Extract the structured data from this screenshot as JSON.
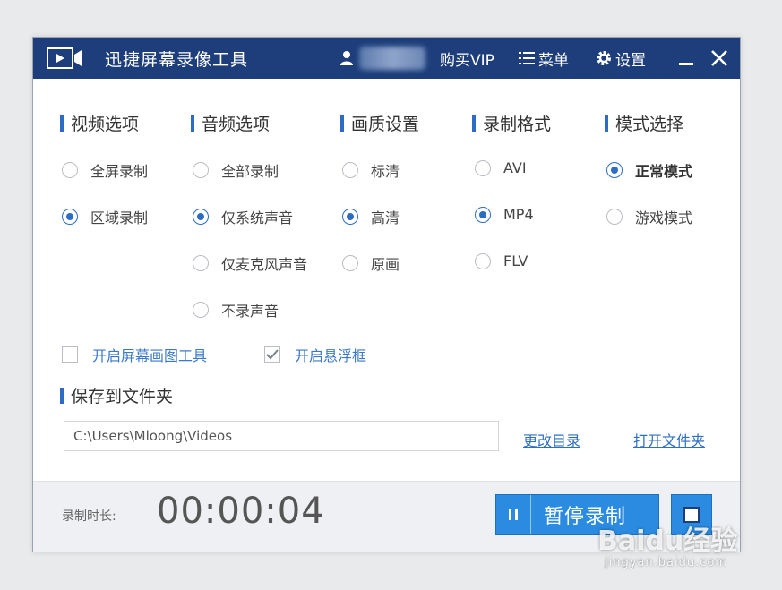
{
  "window": {
    "title": "迅捷屏幕录像工具",
    "buy_vip": "购买VIP",
    "menu": "菜单",
    "settings": "设置"
  },
  "sections": {
    "video": "视频选项",
    "audio": "音频选项",
    "quality": "画质设置",
    "format": "录制格式",
    "mode": "模式选择"
  },
  "video_options": [
    {
      "label": "全屏录制",
      "checked": false
    },
    {
      "label": "区域录制",
      "checked": true
    }
  ],
  "audio_options": [
    {
      "label": "全部录制",
      "checked": false
    },
    {
      "label": "仅系统声音",
      "checked": true
    },
    {
      "label": "仅麦克风声音",
      "checked": false
    },
    {
      "label": "不录声音",
      "checked": false
    }
  ],
  "quality_options": [
    {
      "label": "标清",
      "checked": false
    },
    {
      "label": "高清",
      "checked": true
    },
    {
      "label": "原画",
      "checked": false
    }
  ],
  "format_options": [
    {
      "label": "AVI",
      "checked": false
    },
    {
      "label": "MP4",
      "checked": true
    },
    {
      "label": "FLV",
      "checked": false
    }
  ],
  "mode_options": [
    {
      "label": "正常模式",
      "checked": true
    },
    {
      "label": "游戏模式",
      "checked": false
    }
  ],
  "checkboxes": {
    "draw_tool": {
      "label": "开启屏幕画图工具",
      "checked": false
    },
    "float_box": {
      "label": "开启悬浮框",
      "checked": true
    }
  },
  "save": {
    "title": "保存到文件夹",
    "path": "C:\\Users\\Mloong\\Videos",
    "change_dir": "更改目录",
    "open_folder": "打开文件夹"
  },
  "footer": {
    "duration_label": "录制时长:",
    "duration": "00:00:04",
    "pause_label": "暂停录制"
  },
  "watermark": {
    "brand": "Baidu经验",
    "url": "jingyan.baidu.com"
  },
  "colors": {
    "titlebar": "#1d3e7a",
    "accent": "#2d6cc4",
    "button": "#2a8be0"
  }
}
